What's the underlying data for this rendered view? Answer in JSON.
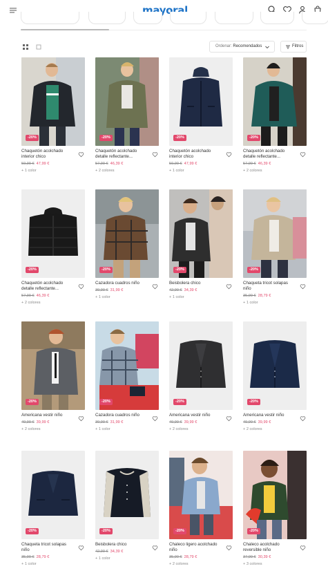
{
  "header": {
    "logo": "mayoral"
  },
  "toolbar": {
    "sort_label": "Ordenar:",
    "sort_value": "Recomendados",
    "filter_label": "Filtros"
  },
  "colors": {
    "brand": "#1f74c7",
    "sale": "#e2486b"
  },
  "products": [
    {
      "title": "Chaquetón acolchado interior chico",
      "old_price": "59,99 €",
      "price": "47,99 €",
      "badge": "-20%",
      "colors": "+ 1 color"
    },
    {
      "title": "Chaquetón acolchado detalle reflectante...",
      "old_price": "57,99 €",
      "price": "46,39 €",
      "badge": "-20%",
      "colors": "+ 2 colores"
    },
    {
      "title": "Chaquetón acolchado interior chico",
      "old_price": "59,99 €",
      "price": "47,99 €",
      "badge": "-20%",
      "colors": "+ 1 color"
    },
    {
      "title": "Chaquetón acolchado detalle reflectante...",
      "old_price": "57,99 €",
      "price": "46,39 €",
      "badge": "-20%",
      "colors": "+ 2 colores"
    },
    {
      "title": "Chaquetón acolchado detalle reflectante...",
      "old_price": "57,99 €",
      "price": "46,39 €",
      "badge": "-20%",
      "colors": "+ 2 colores"
    },
    {
      "title": "Cazadora cuadros niño",
      "old_price": "39,99 €",
      "price": "31,99 €",
      "badge": "-20%",
      "colors": "+ 1 color"
    },
    {
      "title": "Beisbolera chico",
      "old_price": "42,99 €",
      "price": "34,39 €",
      "badge": "-20%",
      "colors": "+ 1 color"
    },
    {
      "title": "Chaqueta tricot solapas niño",
      "old_price": "35,99 €",
      "price": "28,79 €",
      "badge": "-20%",
      "colors": "+ 1 color"
    },
    {
      "title": "Americana vestir niño",
      "old_price": "49,99 €",
      "price": "39,99 €",
      "badge": "-20%",
      "colors": "+ 2 colores"
    },
    {
      "title": "Cazadora cuadros niño",
      "old_price": "39,99 €",
      "price": "31,99 €",
      "badge": "-20%",
      "colors": "+ 1 color"
    },
    {
      "title": "Americana vestir niño",
      "old_price": "49,99 €",
      "price": "39,99 €",
      "badge": "-20%",
      "colors": "+ 2 colores"
    },
    {
      "title": "Americana vestir niño",
      "old_price": "49,99 €",
      "price": "39,99 €",
      "badge": "-20%",
      "colors": "+ 2 colores"
    },
    {
      "title": "Chaqueta tricot solapas niño",
      "old_price": "35,99 €",
      "price": "28,79 €",
      "badge": "-20%",
      "colors": "+ 1 color"
    },
    {
      "title": "Beisbolera chico",
      "old_price": "42,99 €",
      "price": "34,39 €",
      "badge": "-20%",
      "colors": "+ 1 color"
    },
    {
      "title": "Chaleco ligero acolchado niño",
      "old_price": "35,99 €",
      "price": "28,79 €",
      "badge": "-20%",
      "colors": "+ 2 colores"
    },
    {
      "title": "Chaleco acolchado reversible niño",
      "old_price": "37,99 €",
      "price": "30,39 €",
      "badge": "-20%",
      "colors": "+ 3 colores"
    }
  ]
}
